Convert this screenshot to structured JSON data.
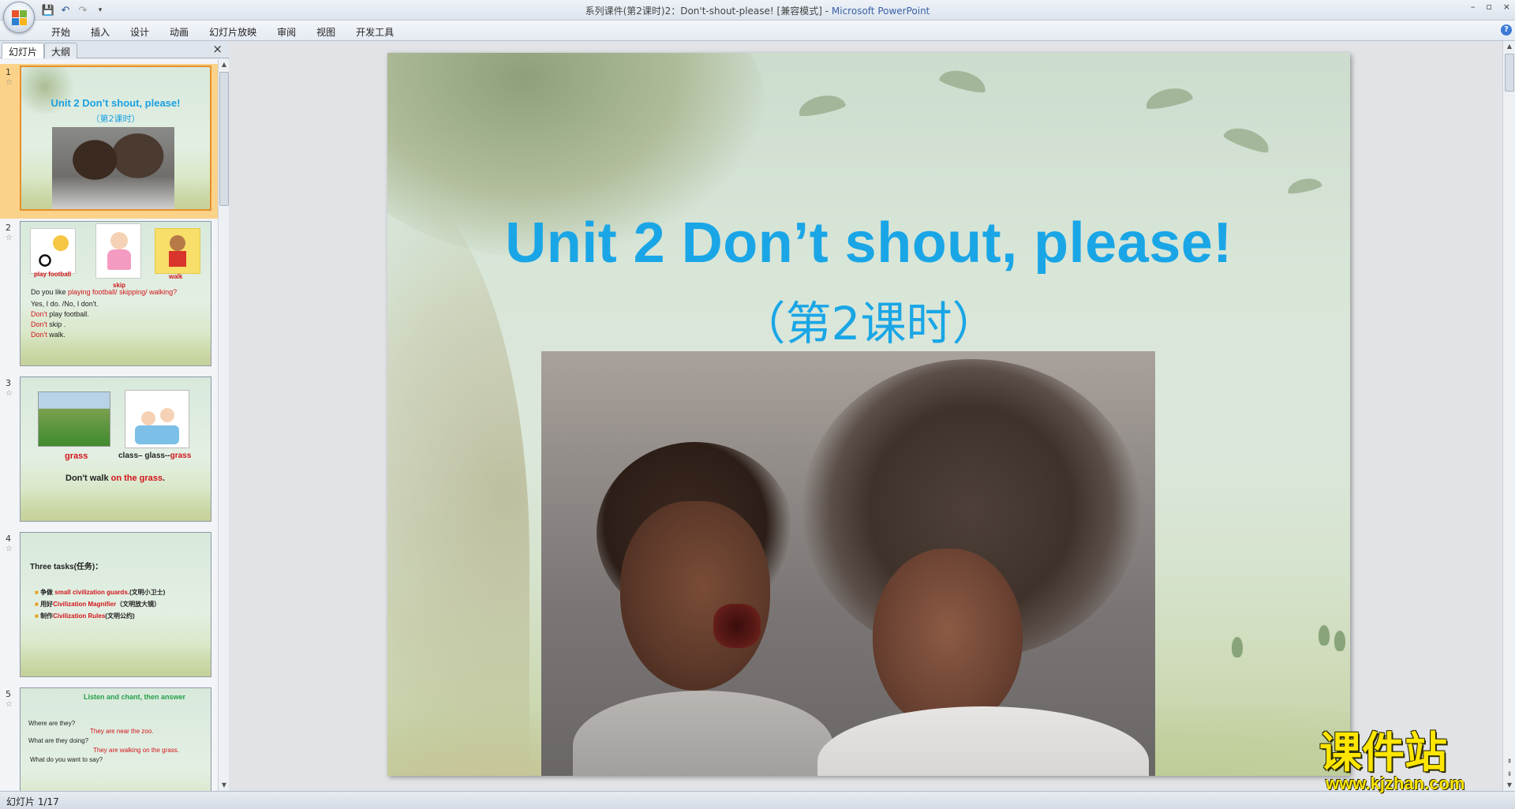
{
  "window": {
    "title": "系列课件(第2课时)2：Don't-shout-please! [兼容模式]",
    "app": "Microsoft PowerPoint",
    "controls": [
      "–",
      "▫",
      "×"
    ]
  },
  "qat": {
    "save": "💾",
    "undo": "↶",
    "redo": "↷",
    "more": "▾"
  },
  "ribbon": {
    "tabs": [
      "开始",
      "插入",
      "设计",
      "动画",
      "幻灯片放映",
      "审阅",
      "视图",
      "开发工具"
    ],
    "help": "?"
  },
  "panel": {
    "tab_slides": "幻灯片",
    "tab_outline": "大纲",
    "close": "×"
  },
  "thumbnails": [
    {
      "num": "1",
      "title": "Unit 2 Don’t shout, please!",
      "subtitle": "（第2课时）"
    },
    {
      "num": "2",
      "labels": [
        "play football",
        "skip",
        "walk"
      ],
      "question_prefix": "Do you like ",
      "question_red": "playing football/ skipping/ walking?",
      "answer": "Yes, I do. /No, I don't.",
      "dont_lines": [
        [
          "Don't",
          " play football."
        ],
        [
          "Don't",
          " skip ."
        ],
        [
          "Don't",
          " walk."
        ]
      ]
    },
    {
      "num": "3",
      "word": "grass",
      "chain": "class– glass--",
      "chain_red": "grass",
      "sentence": "Don't walk ",
      "sentence_red": "on the grass",
      "period": "."
    },
    {
      "num": "4",
      "heading": "Three tasks(任务)：",
      "tasks": [
        {
          "a": "争做 ",
          "b": "small civilization guards.",
          "c": "(文明小卫士)"
        },
        {
          "a": "用好",
          "b": "Civilization Magnifier",
          "c": "（文明放大镜）"
        },
        {
          "a": "制作",
          "b": "Civilization Rules",
          "c": "(文明公约)"
        }
      ]
    },
    {
      "num": "5",
      "heading": "Listen and chant, then answer",
      "lines": [
        {
          "q": "Where are they?",
          "a": "They are near the zoo."
        },
        {
          "q": "What are they doing?",
          "a": "They are walking on the grass."
        },
        {
          "q": "What do you want to say?",
          "a": ""
        }
      ]
    }
  ],
  "slide": {
    "title": "Unit 2 Don’t shout, please!",
    "subtitle": "（第2课时）"
  },
  "status": {
    "text": "幻灯片 1/17"
  },
  "watermark": {
    "cn": "课件站",
    "url": "www.kjzhan.com"
  },
  "colors": {
    "accent_blue": "#1aa6e6",
    "red": "#d2151a",
    "green": "#25a04a",
    "selected_slide": "#fbd289"
  }
}
